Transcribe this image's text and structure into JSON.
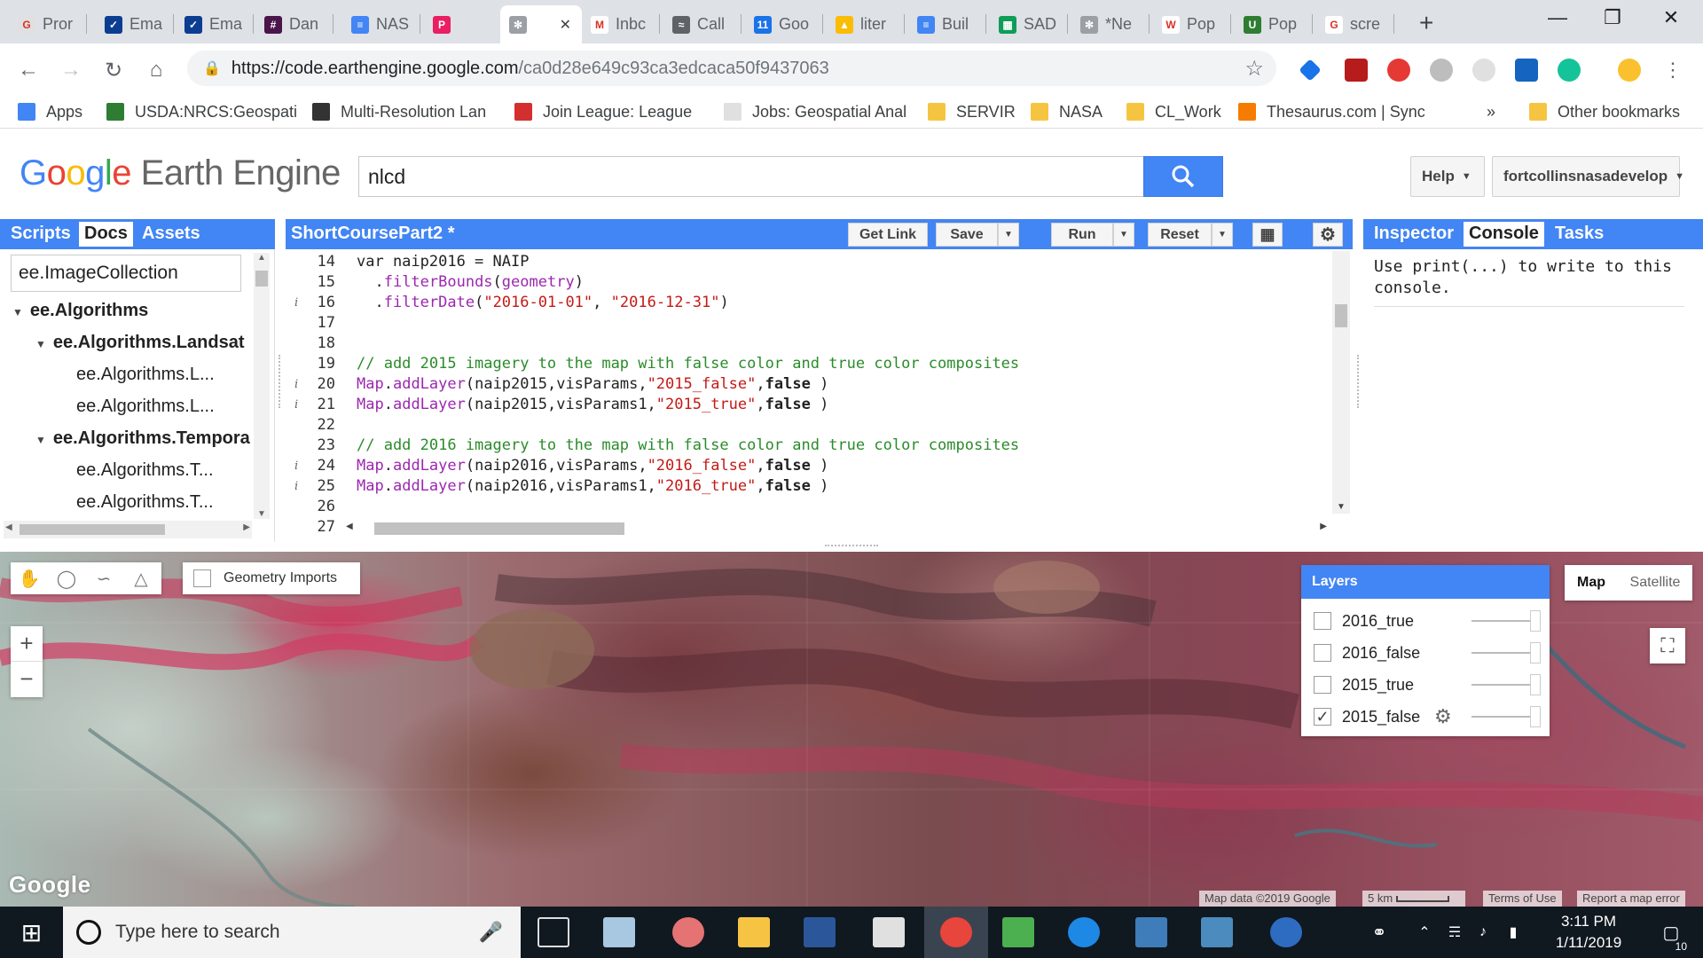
{
  "browser": {
    "tabs": [
      {
        "label": "Pror",
        "color": "#e0e0e0",
        "glyph": "G"
      },
      {
        "label": "Ema",
        "color": "#0b3d91",
        "glyph": "✓"
      },
      {
        "label": "Ema",
        "color": "#0b3d91",
        "glyph": "✓"
      },
      {
        "label": "Dan",
        "color": "#4a154b",
        "glyph": "#"
      },
      {
        "label": "NAS",
        "color": "#4285f4",
        "glyph": "≡"
      },
      {
        "label": "",
        "color": "#e91e63",
        "glyph": "P"
      },
      {
        "label": "",
        "color": "#9aa0a6",
        "glyph": "✻"
      },
      {
        "label": "Inbc",
        "color": "#ffffff",
        "glyph": "M"
      },
      {
        "label": "Call",
        "color": "#5f6368",
        "glyph": "≈"
      },
      {
        "label": "Goo",
        "color": "#1a73e8",
        "glyph": "11"
      },
      {
        "label": "liter",
        "color": "#fbbc04",
        "glyph": "▲"
      },
      {
        "label": "Buil",
        "color": "#4285f4",
        "glyph": "≡"
      },
      {
        "label": "SAD",
        "color": "#0f9d58",
        "glyph": "▦"
      },
      {
        "label": "*Ne",
        "color": "#9aa0a6",
        "glyph": "✻"
      },
      {
        "label": "Pop",
        "color": "#ffffff",
        "glyph": "W"
      },
      {
        "label": "Pop",
        "color": "#2e7d32",
        "glyph": "U"
      },
      {
        "label": "scre",
        "color": "#ffffff",
        "glyph": "G"
      }
    ],
    "new_tab": "+",
    "url_host": "https://code.earthengine.google.com",
    "url_path": "/ca0d28e649c93ca3edcaca50f9437063",
    "bookmarks": [
      {
        "label": "Apps",
        "icon": "apps-icon"
      },
      {
        "label": "USDA:NRCS:Geospati",
        "icon": "usda-icon"
      },
      {
        "label": "Multi-Resolution Lan",
        "icon": "mrlc-icon"
      },
      {
        "label": "Join League: League",
        "icon": "league-icon"
      },
      {
        "label": "Jobs: Geospatial Anal",
        "icon": "page-icon"
      },
      {
        "label": "SERVIR",
        "icon": "folder-icon"
      },
      {
        "label": "NASA",
        "icon": "folder-icon"
      },
      {
        "label": "CL_Work",
        "icon": "folder-icon"
      },
      {
        "label": "Thesaurus.com | Sync",
        "icon": "thesaurus-icon"
      }
    ],
    "bookmarks_more": "»",
    "other_bookmarks": "Other bookmarks"
  },
  "gee": {
    "logo_google": "Google",
    "logo_product": "Earth Engine",
    "search_value": "nlcd",
    "help_label": "Help",
    "account_label": "fortcollinsnasadevelop"
  },
  "left_panel": {
    "tabs": [
      "Scripts",
      "Docs",
      "Assets"
    ],
    "selected": "Docs",
    "search_value": "ee.ImageCollection",
    "tree": [
      {
        "label": "ee.Algorithms",
        "level": 0,
        "bold": true,
        "arrow": "▼"
      },
      {
        "label": "ee.Algorithms.Landsat",
        "level": 1,
        "bold": true,
        "arrow": "▼"
      },
      {
        "label": "ee.Algorithms.L...",
        "level": 2,
        "bold": false,
        "arrow": ""
      },
      {
        "label": "ee.Algorithms.L...",
        "level": 2,
        "bold": false,
        "arrow": ""
      },
      {
        "label": "ee.Algorithms.Tempora",
        "level": 1,
        "bold": true,
        "arrow": "▼"
      },
      {
        "label": "ee.Algorithms.T...",
        "level": 2,
        "bold": false,
        "arrow": ""
      },
      {
        "label": "ee.Algorithms.T...",
        "level": 2,
        "bold": false,
        "arrow": ""
      }
    ]
  },
  "editor": {
    "script_title": "ShortCoursePart2 *",
    "buttons": {
      "get_link": "Get Link",
      "save": "Save",
      "run": "Run",
      "reset": "Reset"
    },
    "line_numbers": [
      "14",
      "15",
      "16",
      "17",
      "18",
      "19",
      "20",
      "21",
      "22",
      "23",
      "24",
      "25",
      "26",
      "27"
    ],
    "info_lines": [
      "16",
      "20",
      "21",
      "24",
      "25"
    ],
    "code": [
      [
        {
          "t": "var naip2016 = NAIP",
          "c": "kw"
        }
      ],
      [
        {
          "t": "  .",
          "c": "kw"
        },
        {
          "t": "filterBounds",
          "c": "fn"
        },
        {
          "t": "(",
          "c": "kw"
        },
        {
          "t": "geometry",
          "c": "fn"
        },
        {
          "t": ")",
          "c": "kw"
        }
      ],
      [
        {
          "t": "  .",
          "c": "kw"
        },
        {
          "t": "filterDate",
          "c": "fn"
        },
        {
          "t": "(",
          "c": "kw"
        },
        {
          "t": "\"2016-01-01\"",
          "c": "str"
        },
        {
          "t": ", ",
          "c": "kw"
        },
        {
          "t": "\"2016-12-31\"",
          "c": "str"
        },
        {
          "t": ")",
          "c": "kw"
        }
      ],
      [],
      [],
      [
        {
          "t": "// add 2015 imagery to the map with false color and true color composites",
          "c": "cm"
        }
      ],
      [
        {
          "t": "Map",
          "c": "fn"
        },
        {
          "t": ".",
          "c": "kw"
        },
        {
          "t": "addLayer",
          "c": "fn"
        },
        {
          "t": "(naip2015,visParams,",
          "c": "kw"
        },
        {
          "t": "\"2015_false\"",
          "c": "str"
        },
        {
          "t": ",",
          "c": "kw"
        },
        {
          "t": "false",
          "c": "bld"
        },
        {
          "t": " )",
          "c": "kw"
        }
      ],
      [
        {
          "t": "Map",
          "c": "fn"
        },
        {
          "t": ".",
          "c": "kw"
        },
        {
          "t": "addLayer",
          "c": "fn"
        },
        {
          "t": "(naip2015,visParams1,",
          "c": "kw"
        },
        {
          "t": "\"2015_true\"",
          "c": "str"
        },
        {
          "t": ",",
          "c": "kw"
        },
        {
          "t": "false",
          "c": "bld"
        },
        {
          "t": " )",
          "c": "kw"
        }
      ],
      [],
      [
        {
          "t": "// add 2016 imagery to the map with false color and true color composites",
          "c": "cm"
        }
      ],
      [
        {
          "t": "Map",
          "c": "fn"
        },
        {
          "t": ".",
          "c": "kw"
        },
        {
          "t": "addLayer",
          "c": "fn"
        },
        {
          "t": "(naip2016,visParams,",
          "c": "kw"
        },
        {
          "t": "\"2016_false\"",
          "c": "str"
        },
        {
          "t": ",",
          "c": "kw"
        },
        {
          "t": "false",
          "c": "bld"
        },
        {
          "t": " )",
          "c": "kw"
        }
      ],
      [
        {
          "t": "Map",
          "c": "fn"
        },
        {
          "t": ".",
          "c": "kw"
        },
        {
          "t": "addLayer",
          "c": "fn"
        },
        {
          "t": "(naip2016,visParams1,",
          "c": "kw"
        },
        {
          "t": "\"2016_true\"",
          "c": "str"
        },
        {
          "t": ",",
          "c": "kw"
        },
        {
          "t": "false",
          "c": "bld"
        },
        {
          "t": " )",
          "c": "kw"
        }
      ],
      [],
      []
    ]
  },
  "right_panel": {
    "tabs": [
      "Inspector",
      "Console",
      "Tasks"
    ],
    "selected": "Console",
    "console_text": "Use print(...) to write to this console."
  },
  "map": {
    "geometry_imports": "Geometry Imports",
    "zoom_in": "+",
    "zoom_out": "−",
    "layers_title": "Layers",
    "layers": [
      {
        "name": "2016_true",
        "checked": false
      },
      {
        "name": "2016_false",
        "checked": false
      },
      {
        "name": "2015_true",
        "checked": false
      },
      {
        "name": "2015_false",
        "checked": true
      }
    ],
    "map_type": {
      "map": "Map",
      "satellite": "Satellite",
      "selected": "Map"
    },
    "google_watermark": "Google",
    "attribution": "Map data ©2019 Google",
    "scale": "5 km",
    "terms": "Terms of Use",
    "report": "Report a map error"
  },
  "taskbar": {
    "search_placeholder": "Type here to search",
    "time": "3:11 PM",
    "date": "1/11/2019",
    "notifications": "10"
  }
}
